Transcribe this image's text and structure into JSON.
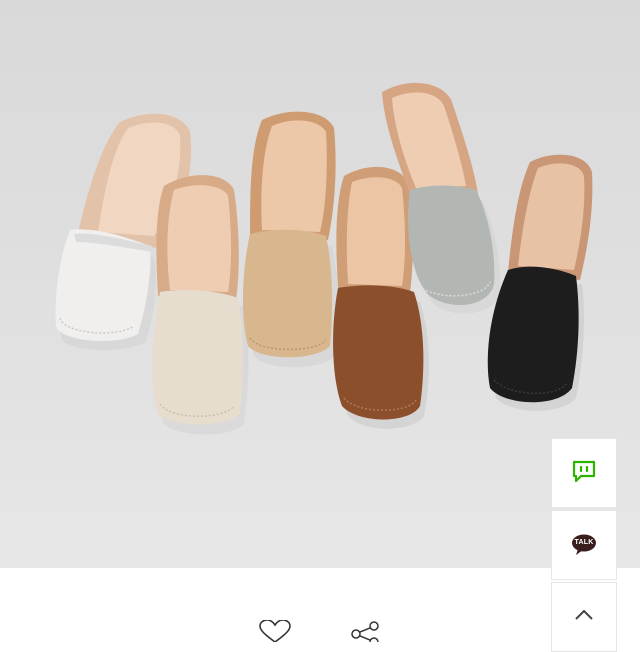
{
  "product": {
    "shoe_colors": [
      "#eeeceb",
      "#e5dccb",
      "#d6b690",
      "#8a4f2c",
      "#b3b8b5",
      "#1d1d1e"
    ]
  },
  "actions": {
    "like_icon": "heart-outline-icon",
    "share_icon": "share-icon"
  },
  "side_buttons": {
    "chat_icon": "chat-bubble-icon",
    "chat_color": "#2db400",
    "talk_label": "TALK",
    "talk_color": "#3a1d1d",
    "top_icon": "chevron-up-icon"
  }
}
